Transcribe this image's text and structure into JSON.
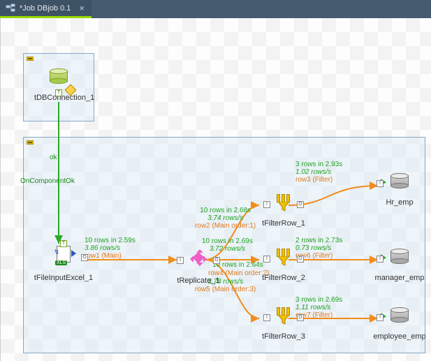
{
  "tab": {
    "title": "*Job DBjob 0.1",
    "close_glyph": "×"
  },
  "job": {
    "subjobs": {
      "top": {
        "collapsed": false
      },
      "main": {
        "collapsed": false
      }
    },
    "nodes": {
      "dbconn": {
        "label": "tDBConnection_1"
      },
      "excel": {
        "label": "tFileInputExcel_1",
        "tag": "XLS"
      },
      "replicate": {
        "label": "tReplicate_1"
      },
      "filter1": {
        "label": "tFilterRow_1"
      },
      "filter2": {
        "label": "tFilterRow_2"
      },
      "filter3": {
        "label": "tFilterRow_3"
      },
      "out1": {
        "label": "Hr_emp"
      },
      "out2": {
        "label": "manager_emp"
      },
      "out3": {
        "label": "employee_emp"
      }
    },
    "links": {
      "trigger1": {
        "midword": "ok",
        "label": "OnComponentOk"
      },
      "row1": {
        "stats1": "10 rows in 2.59s",
        "stats2": "3.86 rows/s",
        "name": "row1 (Main)"
      },
      "row2": {
        "stats1": "10 rows in 2.68s",
        "stats2": "3.74 rows/s",
        "name": "row2 (Main order:1)"
      },
      "row4": {
        "stats1": "10 rows in 2.69s",
        "stats2": "3.72 rows/s",
        "name": "row4 (Main order:2)"
      },
      "row5": {
        "stats1": "10 rows in 2.64s",
        "stats2": "3.78 rows/s",
        "name": "row5 (Main order:3)"
      },
      "row3": {
        "stats1": "3 rows in 2.93s",
        "stats2": "1.02 rows/s",
        "name": "row3 (Filter)"
      },
      "row6": {
        "stats1": "2 rows in 2.73s",
        "stats2": "0.73 rows/s",
        "name": "row6 (Filter)"
      },
      "row7": {
        "stats1": "3 rows in 2.69s",
        "stats2": "1.11 rows/s",
        "name": "row7 (Filter)"
      }
    }
  },
  "colors": {
    "trigger_link": "#2aa82a",
    "data_link": "#f28c1a",
    "subjob_border": "#8aa7c5",
    "subjob_fill": "rgba(218,232,246,0.45)"
  }
}
